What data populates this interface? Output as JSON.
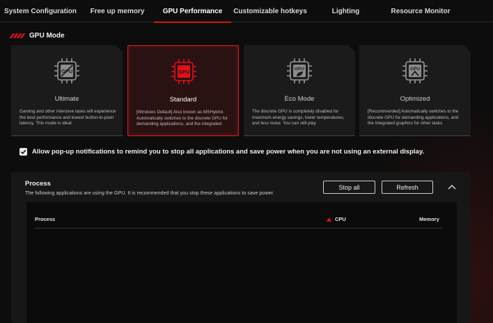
{
  "tabs": [
    {
      "label": "System Configuration",
      "active": false
    },
    {
      "label": "Free up memory",
      "active": false
    },
    {
      "label": "GPU Performance",
      "active": true
    },
    {
      "label": "Customizable hotkeys",
      "active": false
    },
    {
      "label": "Lighting",
      "active": false
    },
    {
      "label": "Resource Monitor",
      "active": false
    }
  ],
  "gpu_mode": {
    "title": "GPU Mode",
    "selected": "Standard",
    "cards": [
      {
        "label": "Ultimate",
        "icon": "gpu-chip-icon",
        "chip_text": "GPU",
        "desc": "Gaming and other intensive tasks will experience the best performance and lowest button-to-pixel latency. This mode is ideal"
      },
      {
        "label": "Standard",
        "icon": "gpu-chip-icon",
        "chip_text": "GPU",
        "desc": "[Windows Default] Also known as MSHybrid. Automatically switches to the discrete GPU for demanding applications, and the integrated"
      },
      {
        "label": "Eco Mode",
        "icon": "gpu-chip-leaf-icon",
        "chip_text": "GPU",
        "desc": "The discrete GPU is completely disabled for maximum energy savings, lower temperatures, and less noise. You can still play"
      },
      {
        "label": "Optimized",
        "icon": "gpu-chip-optimized-icon",
        "chip_text": "GPU",
        "desc": "[Recommended] Automatically switches to the discrete GPU for demanding applications, and the integrated graphics for other tasks"
      }
    ]
  },
  "notification": {
    "checked": true,
    "label": "Allow pop-up notifications to remind you to stop all applications and save power when you are not using an external display."
  },
  "process_panel": {
    "title": "Process",
    "subtitle": "The following applications are using the GPU. It is recommended that you stop these applications to save power.",
    "stop_all_label": "Stop all",
    "refresh_label": "Refresh",
    "columns": {
      "process": "Process",
      "cpu": "CPU",
      "memory": "Memory"
    },
    "rows": []
  },
  "colors": {
    "accent": "#e0111b",
    "background": "#0d0d0d",
    "card": "#1b1b1b"
  }
}
